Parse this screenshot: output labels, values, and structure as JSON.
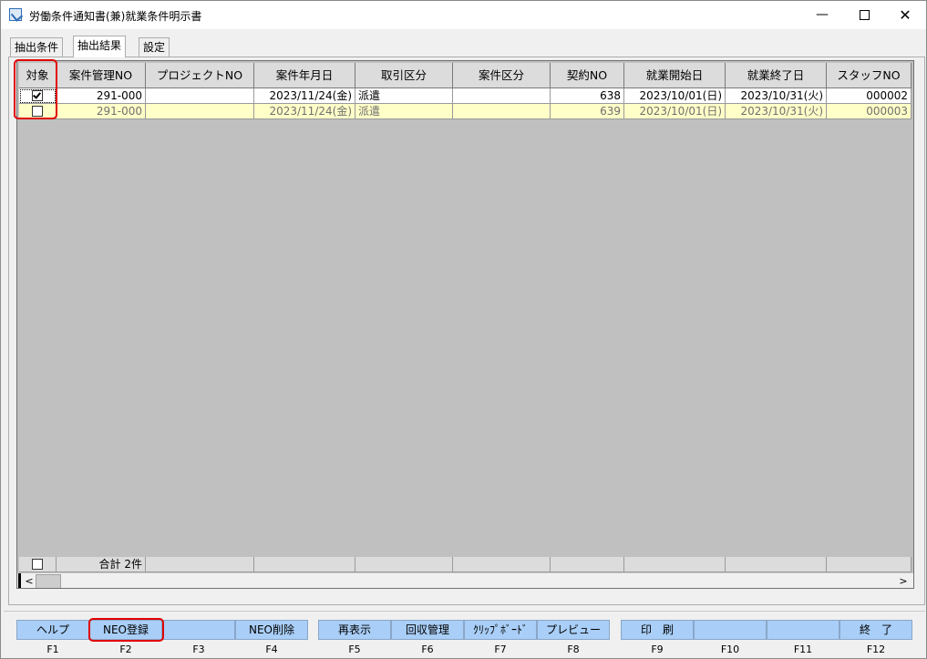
{
  "window": {
    "title": "労働条件通知書(兼)就業条件明示書",
    "controls": {
      "minimize": "—",
      "maximize": "",
      "close": "✕"
    }
  },
  "tabs": [
    {
      "label": "抽出条件",
      "active": false
    },
    {
      "label": "抽出結果",
      "active": true
    },
    {
      "label": "設定",
      "active": false
    }
  ],
  "grid": {
    "columns": [
      "対象",
      "案件管理NO",
      "プロジェクトNO",
      "案件年月日",
      "取引区分",
      "案件区分",
      "契約NO",
      "就業開始日",
      "就業終了日",
      "スタッフNO"
    ],
    "rows": [
      {
        "checked": true,
        "case_no": "291-000",
        "project_no": "",
        "case_date": "2023/11/24(金)",
        "trade_type": "派遣",
        "case_type": "",
        "contract_no": "638",
        "start_date": "2023/10/01(日)",
        "end_date": "2023/10/31(火)",
        "staff_no": "000002"
      },
      {
        "checked": false,
        "case_no": "291-000",
        "project_no": "",
        "case_date": "2023/11/24(金)",
        "trade_type": "派遣",
        "case_type": "",
        "contract_no": "639",
        "start_date": "2023/10/01(日)",
        "end_date": "2023/10/31(火)",
        "staff_no": "000003"
      }
    ],
    "total_label": "合計 2件"
  },
  "scroll": {
    "left_arrow": "<",
    "right_arrow": ">"
  },
  "function_keys": [
    {
      "label": "ヘルプ",
      "key": "F1"
    },
    {
      "label": "NEO登録",
      "key": "F2"
    },
    {
      "label": "",
      "key": "F3"
    },
    {
      "label": "NEO削除",
      "key": "F4"
    },
    {
      "label": "再表示",
      "key": "F5"
    },
    {
      "label": "回収管理",
      "key": "F6"
    },
    {
      "label": "ｸﾘｯﾌﾟﾎﾞｰﾄﾞ",
      "key": "F7"
    },
    {
      "label": "プレビュー",
      "key": "F8"
    },
    {
      "label": "印　刷",
      "key": "F9"
    },
    {
      "label": "",
      "key": "F10"
    },
    {
      "label": "",
      "key": "F11"
    },
    {
      "label": "終　了",
      "key": "F12"
    }
  ],
  "colors": {
    "highlight": "#e00000",
    "button": "#a9cef7",
    "row_alt": "#ffffc8",
    "grid_bg": "#c0c0c0"
  }
}
